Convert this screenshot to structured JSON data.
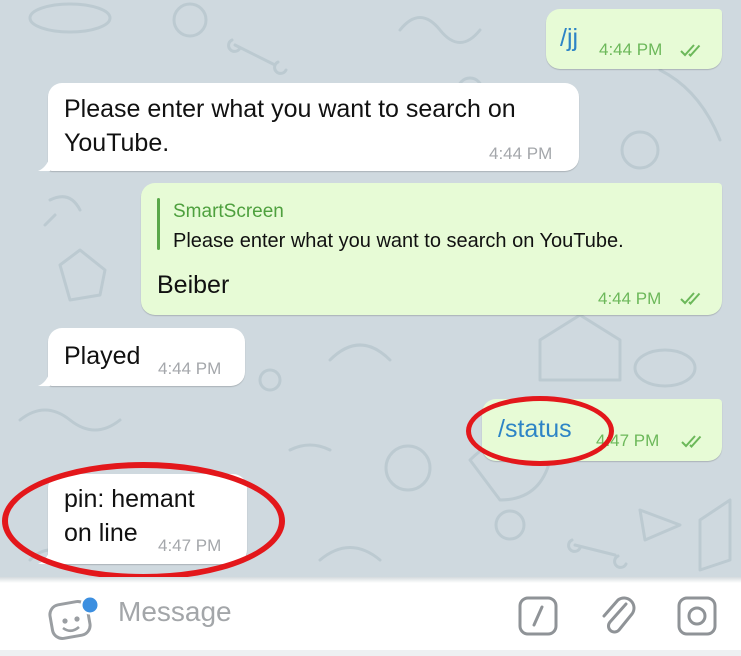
{
  "messages": [
    {
      "type": "outgoing",
      "text": "/jj",
      "time": "4:44 PM"
    },
    {
      "type": "incoming",
      "text_line1": "Please enter what you want to search on",
      "text_line2": "YouTube.",
      "time": "4:44 PM"
    },
    {
      "type": "outgoing_reply",
      "quote_name": "SmartScreen",
      "quote_text": "Please enter what you want to search on YouTube.",
      "text": "Beiber",
      "time": "4:44 PM"
    },
    {
      "type": "incoming",
      "text": "Played",
      "time": "4:44 PM"
    },
    {
      "type": "outgoing",
      "text": "/status",
      "time": "4:47 PM"
    },
    {
      "type": "incoming",
      "text_line1": "pin: hemant",
      "text_line2": "on line",
      "time": "4:47 PM"
    }
  ],
  "input": {
    "placeholder": "Message"
  },
  "colors": {
    "wallpaper": "#cfd9df",
    "incoming_bubble": "#ffffff",
    "outgoing_bubble": "#e7fbd6",
    "outgoing_time": "#6cb85a",
    "command_link": "#2d84c6",
    "annotation": "#e3171b"
  },
  "icons": [
    "sticker-icon",
    "bot-command-icon",
    "attach-paperclip-icon",
    "camera-icon",
    "double-check-icon"
  ]
}
